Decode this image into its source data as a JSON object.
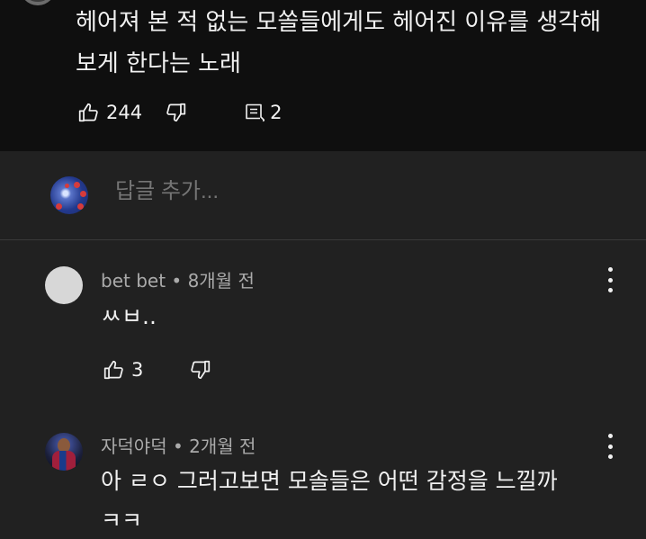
{
  "parent_comment": {
    "text_line1": "헤어져 본 적 없는 모쏠들에게도 헤어진 이유를 생각해",
    "text_line2": "보게 한다는 노래",
    "likes": "244",
    "replies": "2"
  },
  "reply_bar": {
    "placeholder": "답글 추가..."
  },
  "comments": [
    {
      "author": "bet bet",
      "separator": " • ",
      "time": "8개월 전",
      "text": "ㅆㅂ..",
      "likes": "3"
    },
    {
      "author": "자덕야덕",
      "separator": " • ",
      "time": "2개월 전",
      "text_line1": "아 ㄹㅇ 그러고보면 모솔들은 어떤 감정을 느낄까",
      "text_line2": "ㅋㅋ"
    }
  ],
  "icons": {
    "like": "thumbs-up-icon",
    "dislike": "thumbs-down-icon",
    "reply": "reply-comment-icon",
    "more": "more-vert-icon"
  },
  "colors": {
    "parent_bg": "#0f0f0f",
    "thread_bg": "#212121",
    "primary_text": "#f1f1f1",
    "secondary_text": "#aaaaaa"
  }
}
